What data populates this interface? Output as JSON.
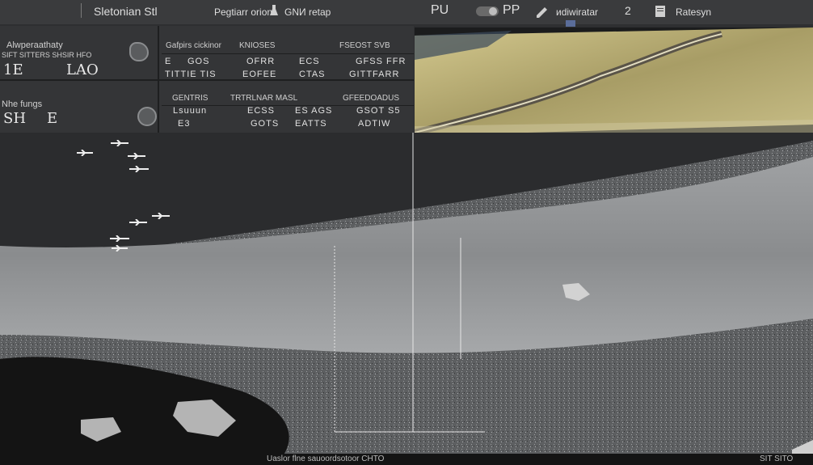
{
  "header": {
    "app_title": "Sletonian Stl",
    "menu_center": "Pegtiarr orion",
    "menu_center_b": "GNИ retap",
    "toolbar_a": "PU",
    "toolbar_b": "PP",
    "toolbar_mid": "иdiwiratar",
    "toolbar_num": "2",
    "toolbar_right": "Ratesyn"
  },
  "panel_top": {
    "title": "Alwperaathaty",
    "subtitle": "SIFT SITTERS SHSIR HFO",
    "big_left": "1E",
    "big_right": "LAO",
    "col_headers": [
      "Gafpirs cickinor",
      "KNIOSES",
      "FSEOST SVB"
    ],
    "row1": [
      "E",
      "GOS",
      "OFRR",
      "ECS",
      "GFSS FFR"
    ],
    "row2": [
      "TITTIE TIS",
      "EOFEE",
      "CTAS",
      "GITTFARR"
    ]
  },
  "panel_bottom": {
    "title": "Nhe fungs",
    "big_left": "SH",
    "big_right": "E",
    "col_headers": [
      "GENTRIS",
      "TRTRLNAR MASL",
      "GFEEDOADUS"
    ],
    "row1": [
      "Lsuuun",
      "ECSS",
      "ES AGS",
      "GSOT S5"
    ],
    "row2": [
      "E3",
      "GOTS",
      "EATTS",
      "ADTIW"
    ]
  },
  "footer": {
    "caption": "Uaslor flne sauoordsotoor CHTO",
    "corner": "SIT SITO"
  },
  "colors": {
    "terrain_tan": "#b8ae7a",
    "scan_gray": "#8c8e90",
    "panel_bg": "#343537"
  },
  "icons": [
    "shell-icon",
    "coin-icon",
    "marker-icon",
    "bird-icon"
  ]
}
